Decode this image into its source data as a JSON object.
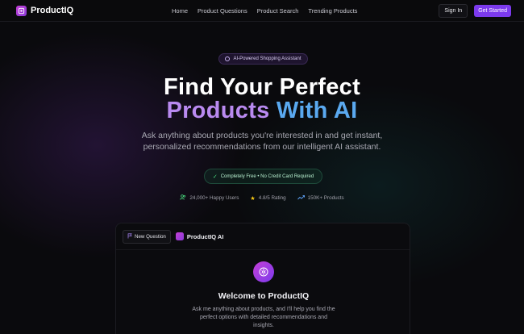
{
  "nav": {
    "brand": "ProductIQ",
    "links": [
      "Home",
      "Product Questions",
      "Product Search",
      "Trending Products"
    ],
    "signin": "Sign In",
    "get_started": "Get Started"
  },
  "hero": {
    "pill": "AI-Powered Shopping Assistant",
    "title_line1": "Find Your Perfect",
    "title_line2_a": "Products",
    "title_line2_b": "With AI",
    "subtitle_line1": "Ask anything about products you're interested in and get instant,",
    "subtitle_line2": "personalized recommendations from our intelligent AI assistant.",
    "free_badge": "Completely Free • No Credit Card Required",
    "stats": [
      {
        "icon": "users-icon",
        "text": "24,000+ Happy Users"
      },
      {
        "icon": "star-icon",
        "text": "4.8/5 Rating"
      },
      {
        "icon": "trending-icon",
        "text": "150K+ Products"
      }
    ]
  },
  "chat": {
    "new_question": "New Question",
    "assistant_name": "ProductIQ AI",
    "welcome_title": "Welcome to ProductIQ",
    "welcome_line1": "Ask me anything about products, and I'll help you find the",
    "welcome_line2": "perfect options with detailed recommendations and",
    "welcome_line3": "insights."
  },
  "colors": {
    "accent": "#7c3aed",
    "brand_gradient_start": "#c43fd6",
    "title_purple": "#b98af0",
    "title_blue": "#5aa9f0",
    "success": "#4ade80",
    "star": "#facc15"
  }
}
